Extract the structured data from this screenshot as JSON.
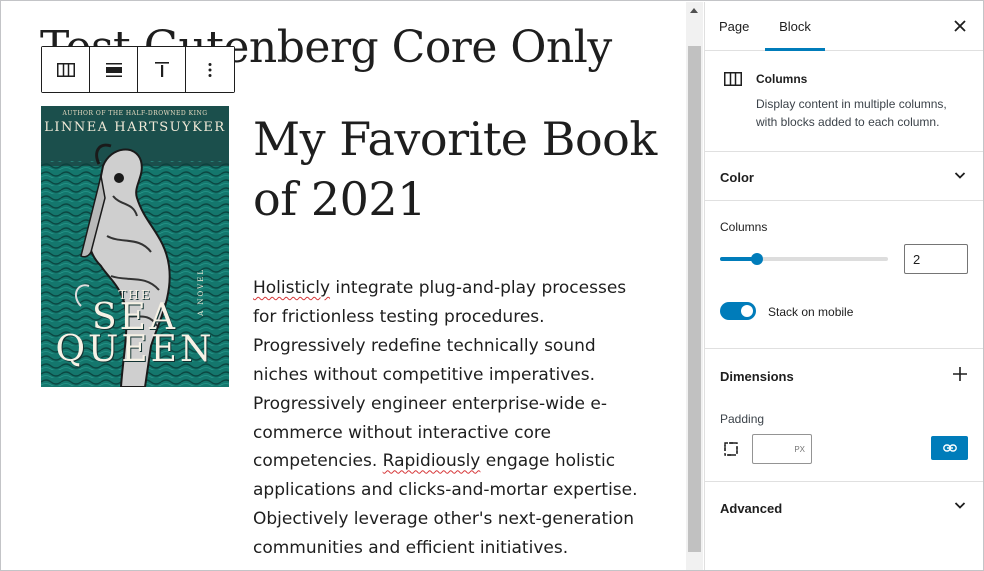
{
  "editor": {
    "post_title": "Test Gutenberg Core Only",
    "toolbar": {
      "buttons": [
        {
          "icon": "columns-icon"
        },
        {
          "icon": "align-icon"
        },
        {
          "icon": "vertical-align-top-icon"
        },
        {
          "icon": "more-options-icon"
        }
      ]
    },
    "cover": {
      "tagline": "AUTHOR OF THE HALF-DROWNED KING",
      "author": "LINNEA HARTSUYKER",
      "novel": "A NOVEL",
      "title_small": "THE",
      "title": "SEA\nQUEEN"
    },
    "heading": "My Favorite Book of 2021",
    "paragraph": {
      "w1": "Holisticly",
      "s1": " integrate plug-and-play processes for frictionless testing procedures. Progressively redefine technically sound niches without competitive imperatives. Progressively engineer enterprise-wide e-commerce without interactive core competencies. ",
      "w2": "Rapidiously",
      "s2": " engage holistic applications and clicks-and-mortar expertise. Objectively leverage other's next-generation communities and efficient initiatives."
    }
  },
  "sidebar": {
    "tabs": [
      {
        "label": "Page",
        "active": false
      },
      {
        "label": "Block",
        "active": true
      }
    ],
    "block_card": {
      "title": "Columns",
      "description": "Display content in multiple columns, with blocks added to each column."
    },
    "color_panel": {
      "title": "Color",
      "expanded": false
    },
    "columns_setting": {
      "label": "Columns",
      "value": "2",
      "range_min": 1,
      "range_max": 6,
      "range_value": 2
    },
    "stack_on_mobile": {
      "label": "Stack on mobile",
      "checked": true
    },
    "dimensions": {
      "title": "Dimensions",
      "padding_label": "Padding",
      "padding_unit": "PX",
      "padding_value": ""
    },
    "advanced_panel": {
      "title": "Advanced",
      "expanded": false
    }
  },
  "colors": {
    "accent": "#007cba",
    "spellcheck": "#d63638",
    "cover_teal": "#11635c"
  }
}
